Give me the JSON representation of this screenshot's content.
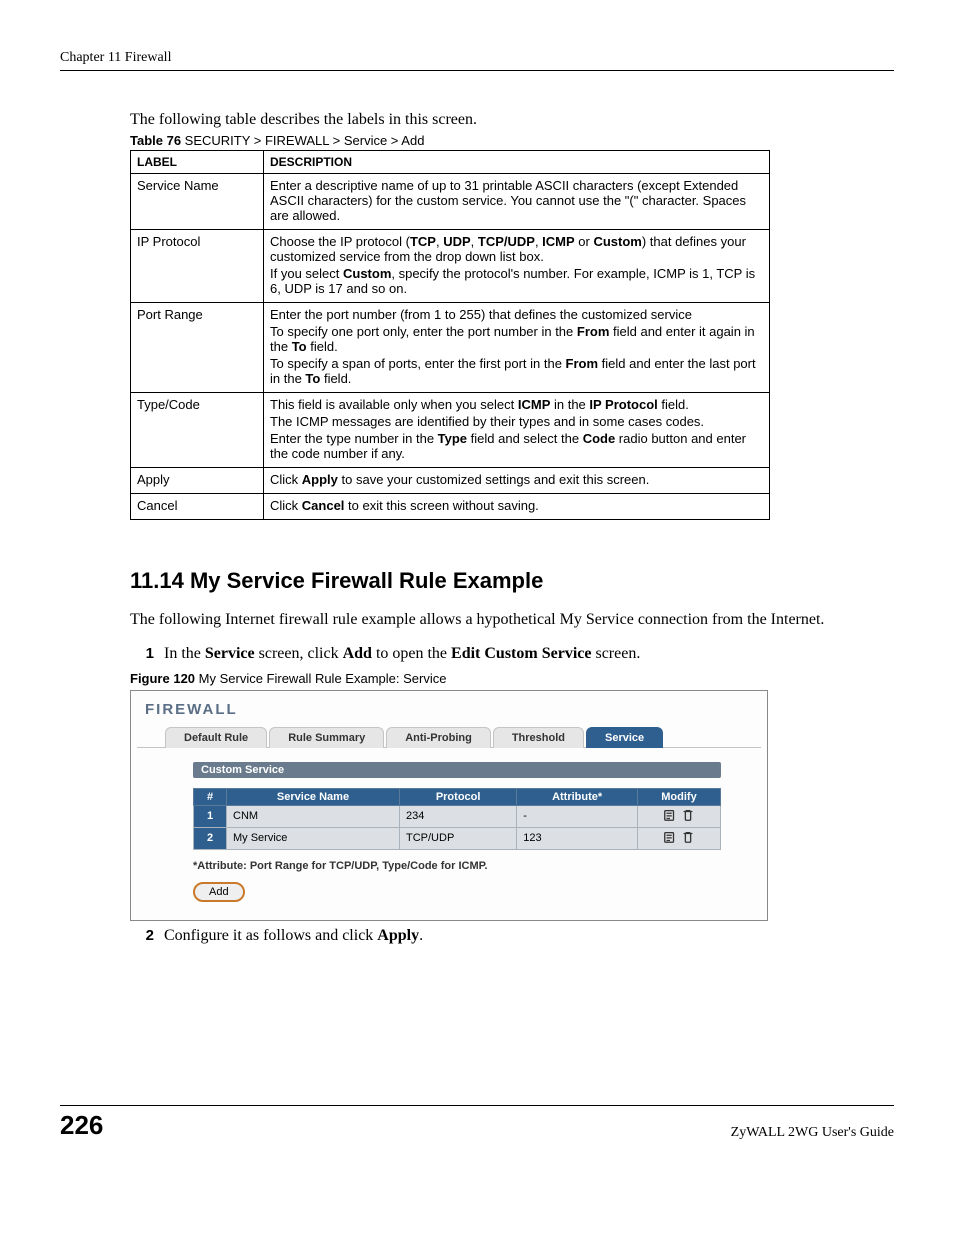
{
  "header": "Chapter 11 Firewall",
  "intro": "The following table describes the labels in this screen.",
  "table_caption": {
    "prefix": "Table 76",
    "text": "   SECURITY > FIREWALL > Service > Add"
  },
  "table_headers": {
    "label": "LABEL",
    "description": "DESCRIPTION"
  },
  "rows": [
    {
      "label": "Service Name",
      "paras": [
        "Enter a descriptive name of up to 31 printable ASCII characters (except Extended ASCII characters) for the custom service. You cannot use the \"(\" character. Spaces are allowed."
      ]
    },
    {
      "label": "IP Protocol",
      "paras": [
        "Choose the IP protocol (<b>TCP</b>, <b>UDP</b>, <b>TCP/UDP</b>, <b>ICMP</b> or <b>Custom</b>) that defines your customized service from the drop down list box.",
        "If you select <b>Custom</b>, specify the protocol's number. For example, ICMP is 1, TCP is 6, UDP is 17 and so on."
      ]
    },
    {
      "label": "Port Range",
      "paras": [
        "Enter the port number (from 1 to 255) that defines the customized service",
        "To specify one port only, enter the port number in the <b>From</b> field and enter it again in the <b>To</b> field.",
        "To specify a span of ports, enter the first port in the <b>From</b> field and enter the last port in the <b>To</b> field."
      ]
    },
    {
      "label": "Type/Code",
      "paras": [
        "This field is available only when you select <b>ICMP</b> in the <b>IP Protocol</b> field.",
        "The ICMP messages are identified by their types and in some cases codes.",
        "Enter the type number in the <b>Type</b> field and select the <b>Code</b> radio button and enter the code number if any."
      ]
    },
    {
      "label": "Apply",
      "paras": [
        "Click <b>Apply</b> to save your customized settings and exit this screen."
      ]
    },
    {
      "label": "Cancel",
      "paras": [
        "Click <b>Cancel</b> to exit this screen without saving."
      ]
    }
  ],
  "section_title": "11.14  My Service Firewall Rule Example",
  "section_body": "The following Internet firewall rule example allows a hypothetical My Service connection from the Internet.",
  "step1": {
    "num": "1",
    "text": "In the <b>Service</b> screen, click <b>Add</b> to open the <b>Edit Custom Service</b> screen."
  },
  "figure_caption": {
    "prefix": "Figure 120",
    "text": "   My Service Firewall Rule Example: Service"
  },
  "figure": {
    "title": "FIREWALL",
    "tabs": [
      "Default Rule",
      "Rule Summary",
      "Anti-Probing",
      "Threshold",
      "Service"
    ],
    "active_tab_index": 4,
    "sub_bar": "Custom Service",
    "headers": [
      "#",
      "Service Name",
      "Protocol",
      "Attribute*",
      "Modify"
    ],
    "rows": [
      {
        "num": "1",
        "name": "CNM",
        "protocol": "234",
        "attr": "-"
      },
      {
        "num": "2",
        "name": "My Service",
        "protocol": "TCP/UDP",
        "attr": "123"
      }
    ],
    "note": "*Attribute: Port Range for TCP/UDP, Type/Code for ICMP.",
    "add_label": "Add"
  },
  "step2": {
    "num": "2",
    "text": "Configure it as follows and click <b>Apply</b>."
  },
  "footer": {
    "page": "226",
    "guide": "ZyWALL 2WG User's Guide"
  }
}
